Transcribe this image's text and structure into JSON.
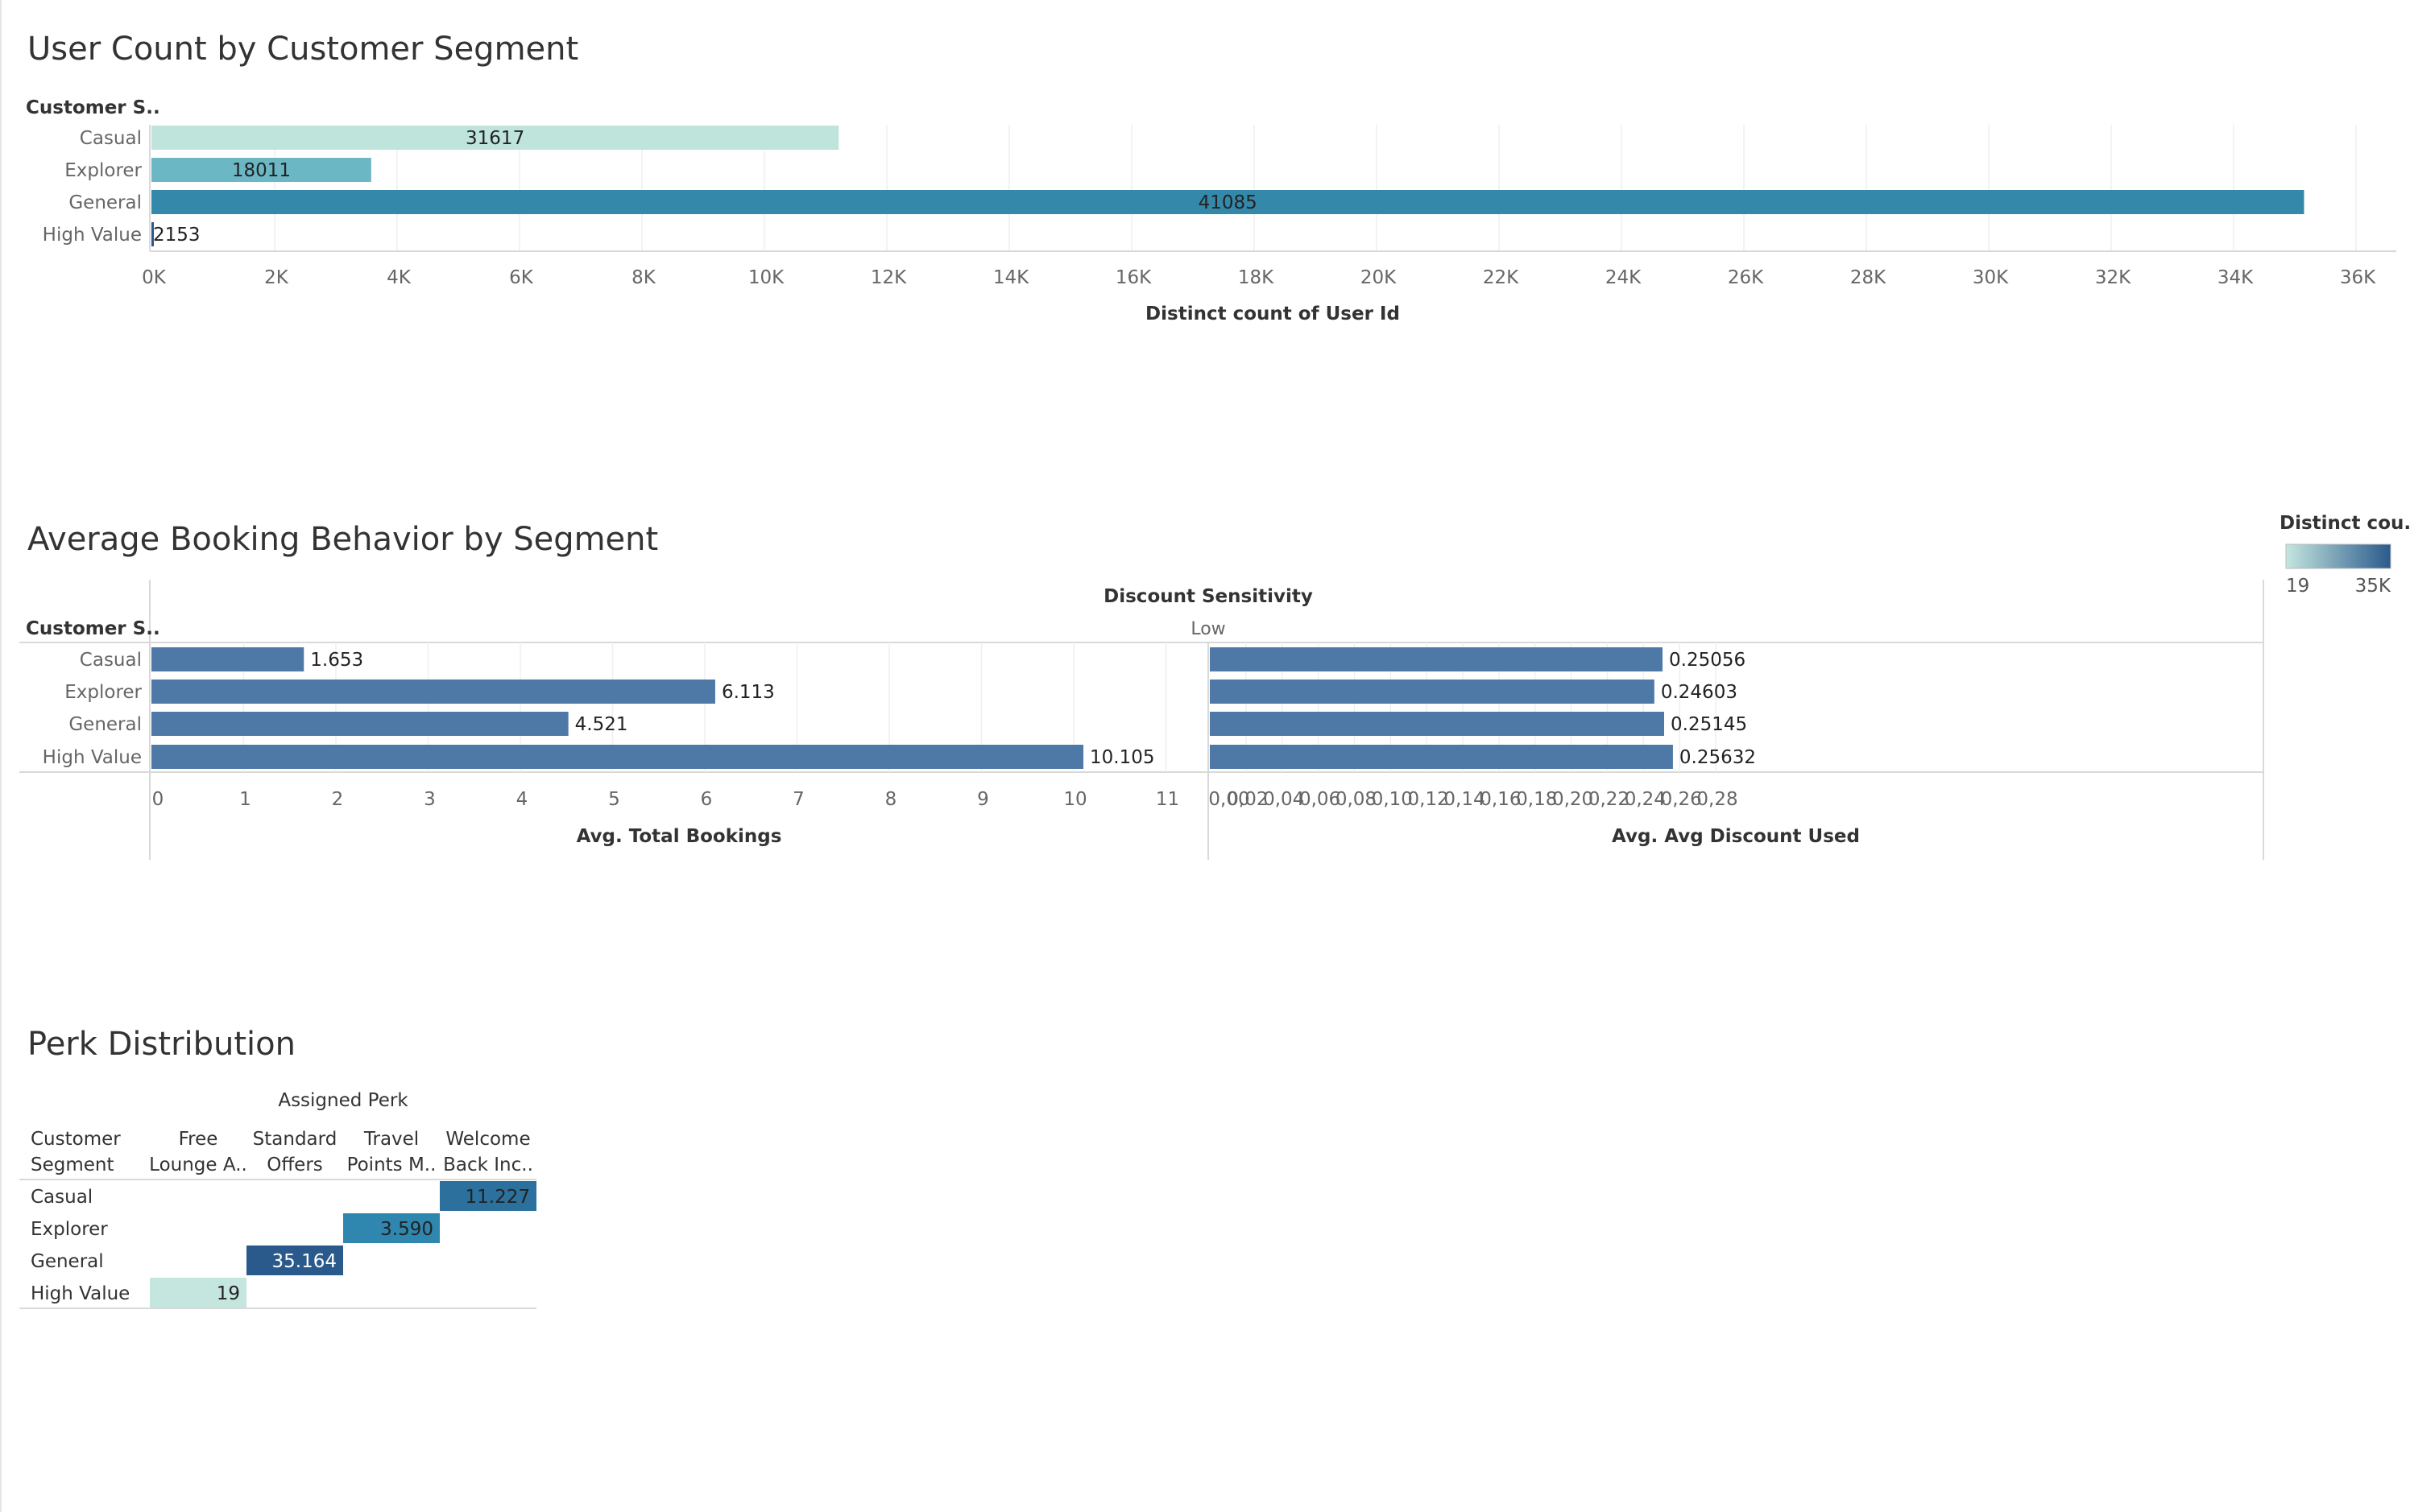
{
  "dashboard": {
    "legend": {
      "title": "Distinct cou..",
      "min_label": "19",
      "max_label": "35K",
      "color_low": "#c4e6df",
      "color_high": "#2a5a8c"
    }
  },
  "chart_data": [
    {
      "type": "bar",
      "title": "User Count by Customer Segment",
      "row_header": "Customer S..",
      "categories": [
        "Casual",
        "Explorer",
        "General",
        "High Value"
      ],
      "values": [
        11227,
        3590,
        35164,
        19
      ],
      "data_labels": [
        "31617",
        "18011",
        "41085",
        "2153"
      ],
      "bar_colors": [
        "#bfe4dc",
        "#6cb7c4",
        "#3489aa",
        "#2a5a8c"
      ],
      "xlabel": "Distinct count of User Id",
      "xlim": [
        0,
        36000
      ],
      "x_ticks": [
        0,
        2000,
        4000,
        6000,
        8000,
        10000,
        12000,
        14000,
        16000,
        18000,
        20000,
        22000,
        24000,
        26000,
        28000,
        30000,
        32000,
        34000,
        36000
      ],
      "x_tick_labels": [
        "0K",
        "2K",
        "4K",
        "6K",
        "8K",
        "10K",
        "12K",
        "14K",
        "16K",
        "18K",
        "20K",
        "22K",
        "24K",
        "26K",
        "28K",
        "30K",
        "32K",
        "34K",
        "36K"
      ],
      "grid": true
    },
    {
      "type": "bar",
      "title": "Average Booking Behavior by Segment",
      "column_header": "Discount Sensitivity",
      "column_value": "Low",
      "row_header": "Customer S..",
      "categories": [
        "Casual",
        "Explorer",
        "General",
        "High Value"
      ],
      "bar_color": "#4e79a7",
      "panels": [
        {
          "measure": "Avg. Total Bookings",
          "values": [
            1.653,
            6.113,
            4.521,
            10.105
          ],
          "data_labels": [
            "1.653",
            "6.113",
            "4.521",
            "10.105"
          ],
          "xlim": [
            0,
            11.5
          ],
          "x_ticks": [
            0,
            1,
            2,
            3,
            4,
            5,
            6,
            7,
            8,
            9,
            10,
            11
          ],
          "x_tick_labels": [
            "0",
            "1",
            "2",
            "3",
            "4",
            "5",
            "6",
            "7",
            "8",
            "9",
            "10",
            "11"
          ]
        },
        {
          "measure": "Avg. Avg Discount Used",
          "values": [
            0.25056,
            0.24603,
            0.25145,
            0.25632
          ],
          "data_labels": [
            "0.25056",
            "0.24603",
            "0.25145",
            "0.25632"
          ],
          "xlim": [
            0,
            0.29
          ],
          "x_ticks": [
            0,
            0.02,
            0.04,
            0.06,
            0.08,
            0.1,
            0.12,
            0.14,
            0.16,
            0.18,
            0.2,
            0.22,
            0.24,
            0.26,
            0.28
          ],
          "x_tick_labels": [
            "0,00",
            "0,02",
            "0,04",
            "0,06",
            "0,08",
            "0,10",
            "0,12",
            "0,14",
            "0,16",
            "0,18",
            "0,20",
            "0,22",
            "0,24",
            "0,26",
            "0,28"
          ]
        }
      ],
      "grid": true
    },
    {
      "type": "heatmap",
      "title": "Perk Distribution",
      "column_header": "Assigned Perk",
      "row_header_lines": [
        "Customer",
        "Segment"
      ],
      "columns": [
        [
          "Free",
          "Lounge A.."
        ],
        [
          "Standard",
          "Offers"
        ],
        [
          "Travel",
          "Points M.."
        ],
        [
          "Welcome",
          "Back Inc.."
        ]
      ],
      "rows": [
        "Casual",
        "Explorer",
        "General",
        "High Value"
      ],
      "cells": [
        {
          "row": 0,
          "col": 3,
          "value": 11227,
          "label": "11.227"
        },
        {
          "row": 1,
          "col": 2,
          "value": 3590,
          "label": "3.590"
        },
        {
          "row": 2,
          "col": 1,
          "value": 35164,
          "label": "35.164"
        },
        {
          "row": 3,
          "col": 0,
          "value": 19,
          "label": "19"
        }
      ],
      "color_range": [
        19,
        35164
      ]
    }
  ]
}
